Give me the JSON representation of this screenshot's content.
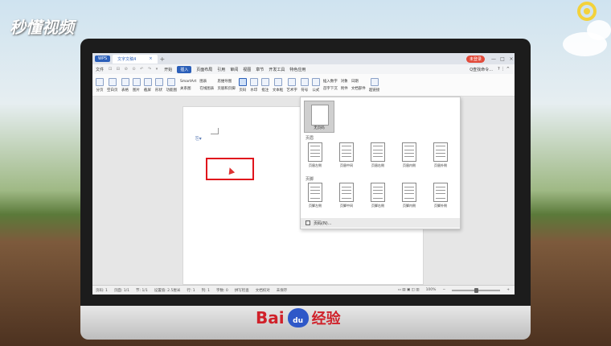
{
  "watermark": {
    "brand": "秒懂视频"
  },
  "app": {
    "app_tab": "WPS",
    "doc_tab": "文字文稿4",
    "add_tab": "+",
    "login": "未登录",
    "win_controls": [
      "—",
      "□",
      "×"
    ]
  },
  "menu": {
    "file": "文件",
    "tools": "⊡ ⊟ ⊘ ⊙ ↶ ↷ ▾",
    "items": [
      "开始",
      "插入",
      "页面布局",
      "引用",
      "审阅",
      "视图",
      "章节",
      "开发工具",
      "特色应用"
    ],
    "active_index": 1,
    "search": "Q查找命令..."
  },
  "ribbon": {
    "groups": [
      "分页",
      "空白页",
      "表格",
      "图片",
      "截屏",
      "形状",
      "功能图",
      "SmartArt",
      "图表",
      "在线图表",
      "关系图",
      "思维导图",
      "页眉和页脚",
      "页码",
      "水印",
      "批注",
      "文本框",
      "艺术字",
      "符号",
      "公式",
      "插入数字",
      "首字下沉",
      "对象",
      "日期",
      "附件",
      "文档部件",
      "超链接"
    ]
  },
  "dropdown": {
    "blank_label": "无页码",
    "header_section": "页眉",
    "header_items": [
      "页眉左侧",
      "页眉中间",
      "页眉右侧",
      "页眉内侧",
      "页眉外侧"
    ],
    "footer_section": "页脚",
    "footer_items": [
      "页脚左侧",
      "页脚中间",
      "页脚右侧",
      "页脚内侧",
      "页脚外侧"
    ],
    "more_label": "页码(N)..."
  },
  "statusbar": {
    "items": [
      "页码: 1",
      "页面: 1/1",
      "节: 1/1",
      "设置值: 2.5厘米",
      "行: 1",
      "列: 1",
      "字数: 0",
      "拼写检查",
      "文档校对",
      "未保存"
    ],
    "zoom": "100%"
  },
  "baidu": {
    "brand": "Bai",
    "du": "du",
    "suffix": "经验"
  },
  "colors": {
    "accent": "#2b5fb9",
    "highlight": "#e0141c"
  }
}
